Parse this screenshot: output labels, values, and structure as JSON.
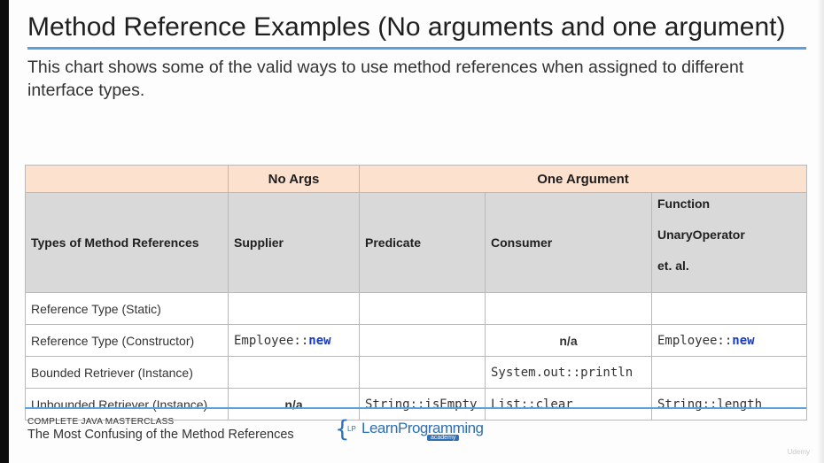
{
  "title": "Method Reference Examples (No arguments and one argument)",
  "subtitle": "This chart shows some of the valid ways to use method references when assigned to different interface types.",
  "table": {
    "groups": {
      "blank": "",
      "no_args": "No Args",
      "one_argument": "One Argument"
    },
    "columns": {
      "types": "Types of Method References",
      "supplier": "Supplier",
      "predicate": "Predicate",
      "consumer": "Consumer",
      "function": "Function",
      "unary_operator": "UnaryOperator",
      "etal": "et. al."
    },
    "rows": [
      {
        "label": "Reference Type (Static)"
      },
      {
        "label": "Reference Type (Constructor)",
        "supplier_cls": "Employee::",
        "supplier_kw": "new",
        "consumer": "n/a",
        "function_cls": "Employee::",
        "function_kw": "new"
      },
      {
        "label": "Bounded Retriever (Instance)",
        "consumer": "System.out::println"
      },
      {
        "label": "Unbounded Retriever (Instance)",
        "supplier": "n/a",
        "predicate": "String::isEmpty",
        "consumer": "List::clear",
        "function": "String::length"
      }
    ]
  },
  "footer": {
    "course": "COMPLETE JAVA MASTERCLASS",
    "caption": "The Most Confusing of the Method References",
    "logo_lp": "LP",
    "logo_text": "LearnProgramming",
    "logo_sub": "academy"
  },
  "watermark": "Udemy",
  "colors": {
    "accent": "#5aa0dc",
    "group_header": "#fde1cf",
    "column_header": "#d9d9d9",
    "keyword": "#1a3ab8"
  }
}
